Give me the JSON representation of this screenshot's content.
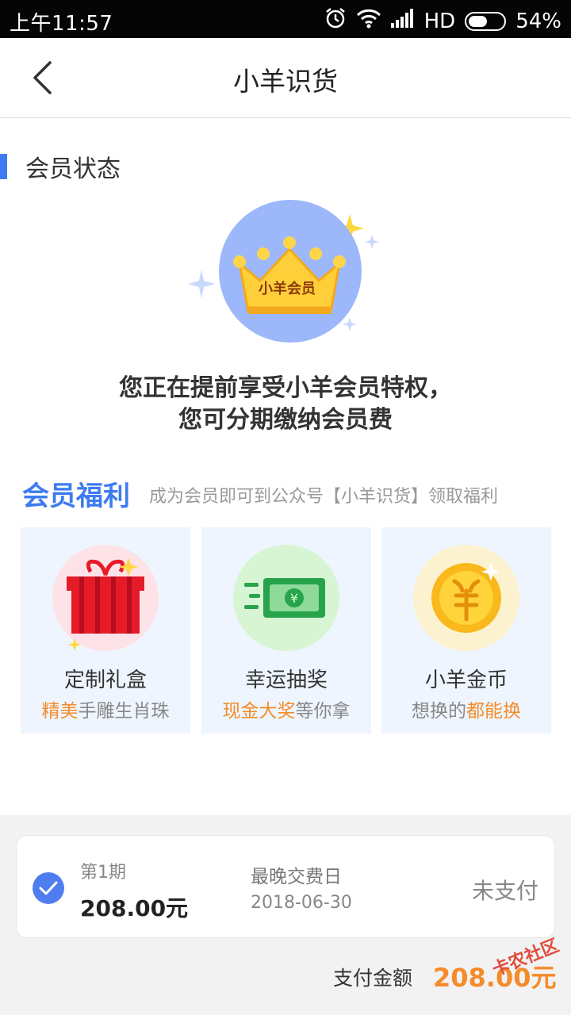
{
  "status_bar": {
    "time": "上午11:57",
    "network": "HD",
    "battery": "54%",
    "battery_level": 0.54
  },
  "header": {
    "title": "小羊识货"
  },
  "member_status": {
    "section_title": "会员状态",
    "badge_text": "小羊会员",
    "headline_line1": "您正在提前享受小羊会员特权，",
    "headline_line2": "您可分期缴纳会员费"
  },
  "benefits": {
    "title": "会员福利",
    "subtitle": "成为会员即可到公众号【小羊识货】领取福利",
    "cards": [
      {
        "title": "定制礼盒",
        "highlight": "精美",
        "desc": "手雕生肖珠",
        "icon": "gift-box-icon"
      },
      {
        "title": "幸运抽奖",
        "highlight": "现金大奖",
        "desc": "等你拿",
        "icon": "cash-icon"
      },
      {
        "title": "小羊金币",
        "prefix": "想换的",
        "highlight": "都能换",
        "icon": "gold-coin-icon"
      }
    ]
  },
  "installment": {
    "period": "第1期",
    "amount": "208.00元",
    "due_label": "最晚交费日",
    "due_date": "2018-06-30",
    "status": "未支付"
  },
  "payment": {
    "label": "支付金额",
    "value": "208.00元"
  },
  "watermark": "卡农社区",
  "colors": {
    "accent": "#3e7bf2",
    "highlight": "#f58b2a",
    "card_bg": "#eef5fe"
  }
}
